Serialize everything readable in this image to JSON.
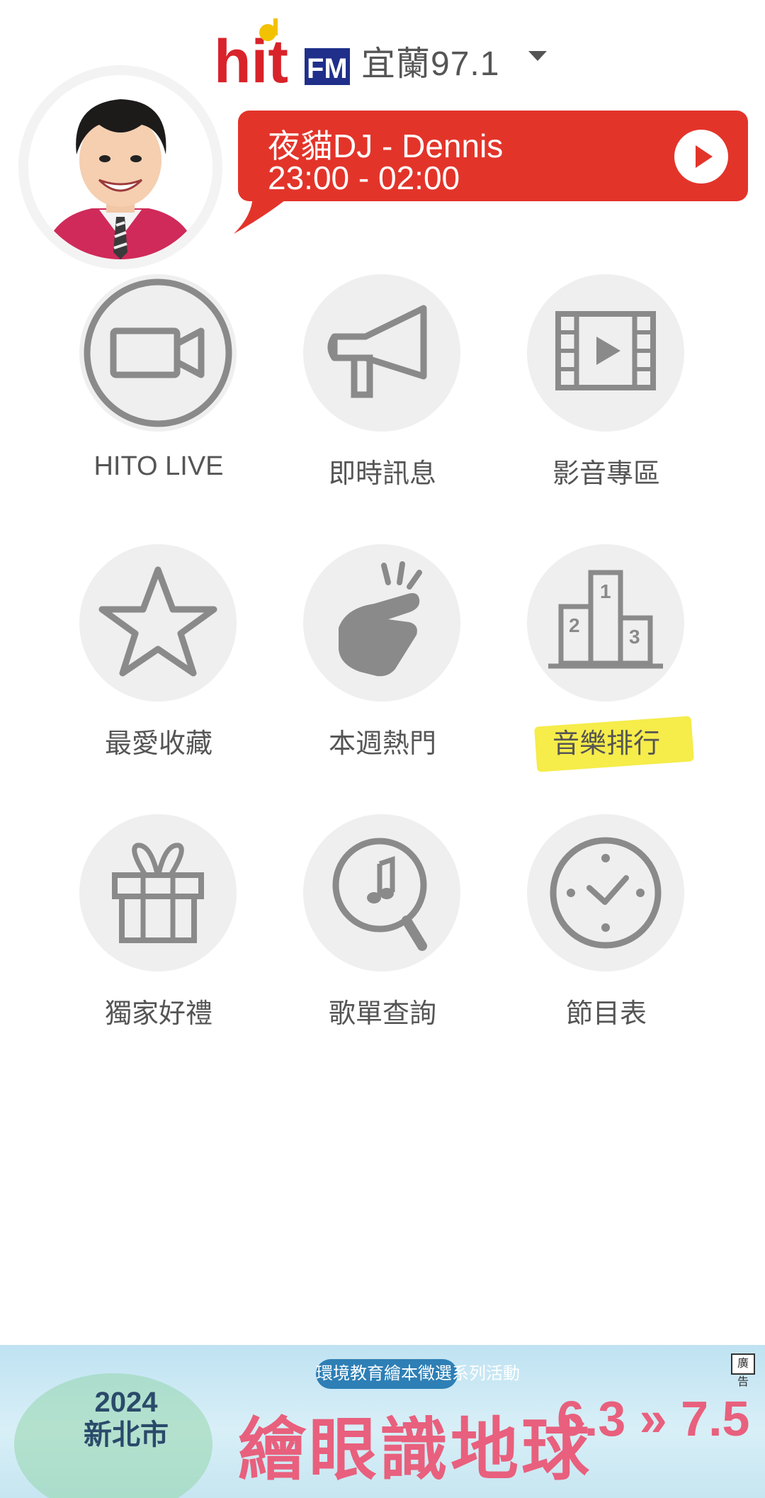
{
  "header": {
    "logo_text": "hit FM",
    "station": "宜蘭97.1"
  },
  "now_playing": {
    "dj_name": "夜貓DJ - Dennis",
    "time": "23:00 - 02:00"
  },
  "menu": {
    "items": [
      {
        "label": "HITO LIVE",
        "icon": "video-camera-icon"
      },
      {
        "label": "即時訊息",
        "icon": "megaphone-icon"
      },
      {
        "label": "影音專區",
        "icon": "film-play-icon"
      },
      {
        "label": "最愛收藏",
        "icon": "star-icon"
      },
      {
        "label": "本週熱門",
        "icon": "snap-fingers-icon"
      },
      {
        "label": "音樂排行",
        "icon": "podium-icon"
      },
      {
        "label": "獨家好禮",
        "icon": "gift-icon"
      },
      {
        "label": "歌單查詢",
        "icon": "music-search-icon"
      },
      {
        "label": "節目表",
        "icon": "clock-icon"
      }
    ]
  },
  "ad": {
    "tag": "廣告",
    "subtitle": "環境教育繪本徵選系列活動",
    "title": "繪眼識地球",
    "year": "2024",
    "city": "新北市",
    "date_range": "6.3 » 7.5"
  },
  "colors": {
    "accent_red": "#e3342a",
    "icon_gray": "#8a8a8a",
    "circle_bg": "#efefef",
    "highlight_yellow": "#f6ec4a"
  }
}
